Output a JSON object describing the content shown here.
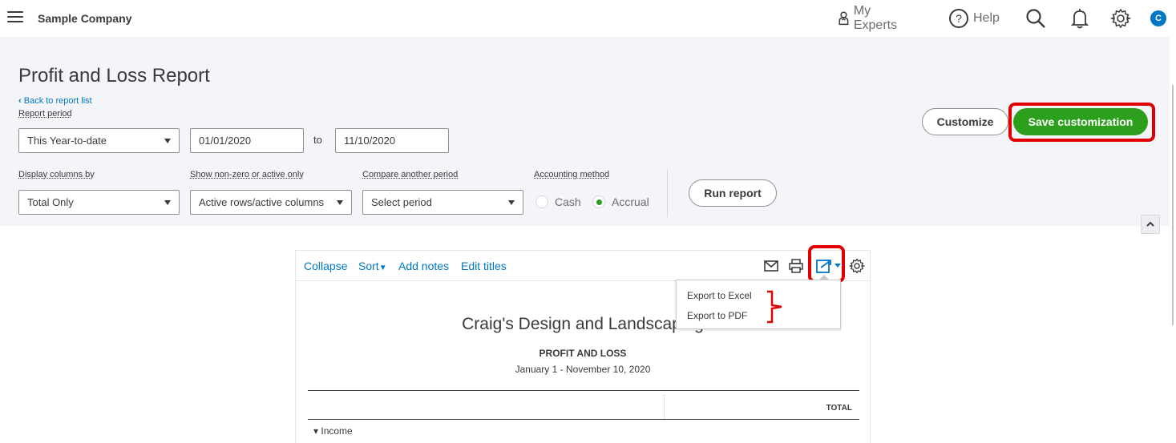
{
  "topbar": {
    "company_name": "Sample Company",
    "my_experts": "My Experts",
    "help": "Help",
    "avatar_initial": "C"
  },
  "header": {
    "title": "Profit and Loss Report",
    "back_link": "Back to report list",
    "report_period_label": "Report period",
    "report_period_value": "This Year-to-date",
    "date_from": "01/01/2020",
    "to_label": "to",
    "date_to": "11/10/2020",
    "display_columns_label": "Display columns by",
    "display_columns_value": "Total Only",
    "show_nonzero_label": "Show non-zero or active only",
    "show_nonzero_value": "Active rows/active columns",
    "compare_label": "Compare another period",
    "compare_value": "Select period",
    "accounting_label": "Accounting method",
    "cash_label": "Cash",
    "accrual_label": "Accrual",
    "accounting_selected": "Accrual",
    "run_report": "Run report",
    "customize": "Customize",
    "save_customization": "Save customization"
  },
  "report": {
    "toolbar": {
      "collapse": "Collapse",
      "sort": "Sort",
      "add_notes": "Add notes",
      "edit_titles": "Edit titles"
    },
    "company": "Craig's Design and Landscaping",
    "title": "PROFIT AND LOSS",
    "dates": "January 1 - November 10, 2020",
    "total_header": "TOTAL",
    "first_row": "Income"
  },
  "export_menu": {
    "items": [
      "Export to Excel",
      "Export to PDF"
    ]
  },
  "colors": {
    "brand_green": "#2ca01c",
    "link_blue": "#0077c5",
    "highlight_red": "#e00000",
    "header_bg": "#f4f5f8"
  }
}
